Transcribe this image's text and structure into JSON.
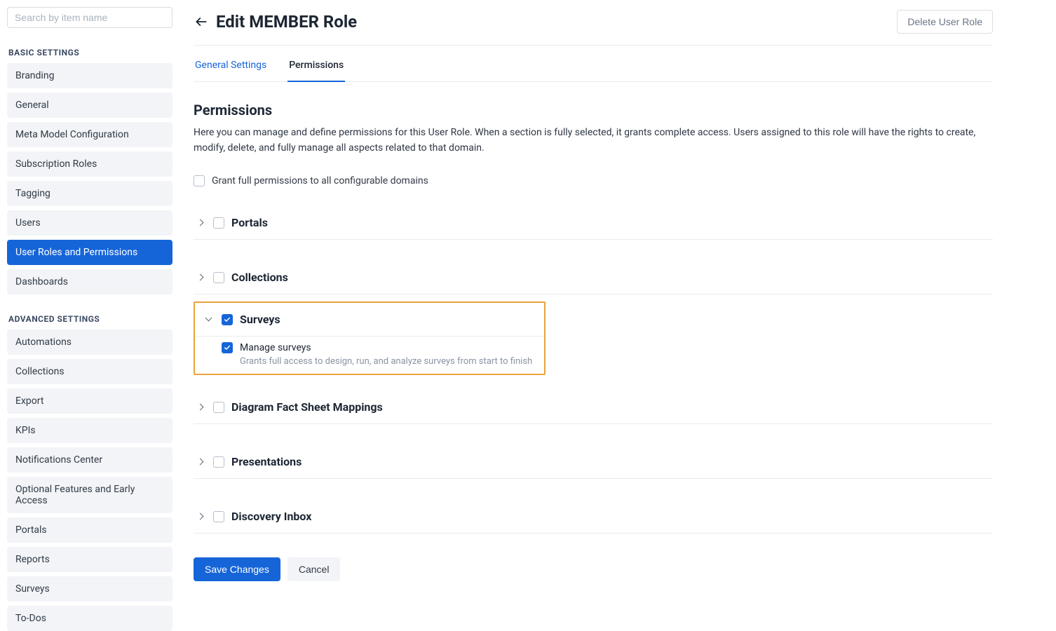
{
  "sidebar": {
    "search_placeholder": "Search by item name",
    "basic_header": "BASIC SETTINGS",
    "advanced_header": "ADVANCED SETTINGS",
    "basic_items": [
      {
        "label": "Branding"
      },
      {
        "label": "General"
      },
      {
        "label": "Meta Model Configuration"
      },
      {
        "label": "Subscription Roles"
      },
      {
        "label": "Tagging"
      },
      {
        "label": "Users"
      },
      {
        "label": "User Roles and Permissions"
      },
      {
        "label": "Dashboards"
      }
    ],
    "advanced_items": [
      {
        "label": "Automations"
      },
      {
        "label": "Collections"
      },
      {
        "label": "Export"
      },
      {
        "label": "KPIs"
      },
      {
        "label": "Notifications Center"
      },
      {
        "label": "Optional Features and Early Access"
      },
      {
        "label": "Portals"
      },
      {
        "label": "Reports"
      },
      {
        "label": "Surveys"
      },
      {
        "label": "To-Dos"
      }
    ],
    "active_index": 6
  },
  "header": {
    "title": "Edit MEMBER Role",
    "delete_label": "Delete User Role"
  },
  "tabs": {
    "items": [
      {
        "label": "General Settings"
      },
      {
        "label": "Permissions"
      }
    ],
    "active_index": 1
  },
  "permissions": {
    "title": "Permissions",
    "description": "Here you can manage and define permissions for this User Role. When a section is fully selected, it grants complete access. Users assigned to this role will have the rights to create, modify, delete, and fully manage all aspects related to that domain.",
    "grant_all_label": "Grant full permissions to all configurable domains",
    "groups": [
      {
        "label": "Portals",
        "checked": false,
        "expanded": false
      },
      {
        "label": "Collections",
        "checked": false,
        "expanded": false
      },
      {
        "label": "Surveys",
        "checked": true,
        "expanded": true,
        "highlighted": true,
        "children": [
          {
            "label": "Manage surveys",
            "checked": true,
            "description": "Grants full access to design, run, and analyze surveys from start to finish"
          }
        ]
      },
      {
        "label": "Diagram Fact Sheet Mappings",
        "checked": false,
        "expanded": false
      },
      {
        "label": "Presentations",
        "checked": false,
        "expanded": false
      },
      {
        "label": "Discovery Inbox",
        "checked": false,
        "expanded": false
      }
    ]
  },
  "footer": {
    "save_label": "Save Changes",
    "cancel_label": "Cancel"
  }
}
